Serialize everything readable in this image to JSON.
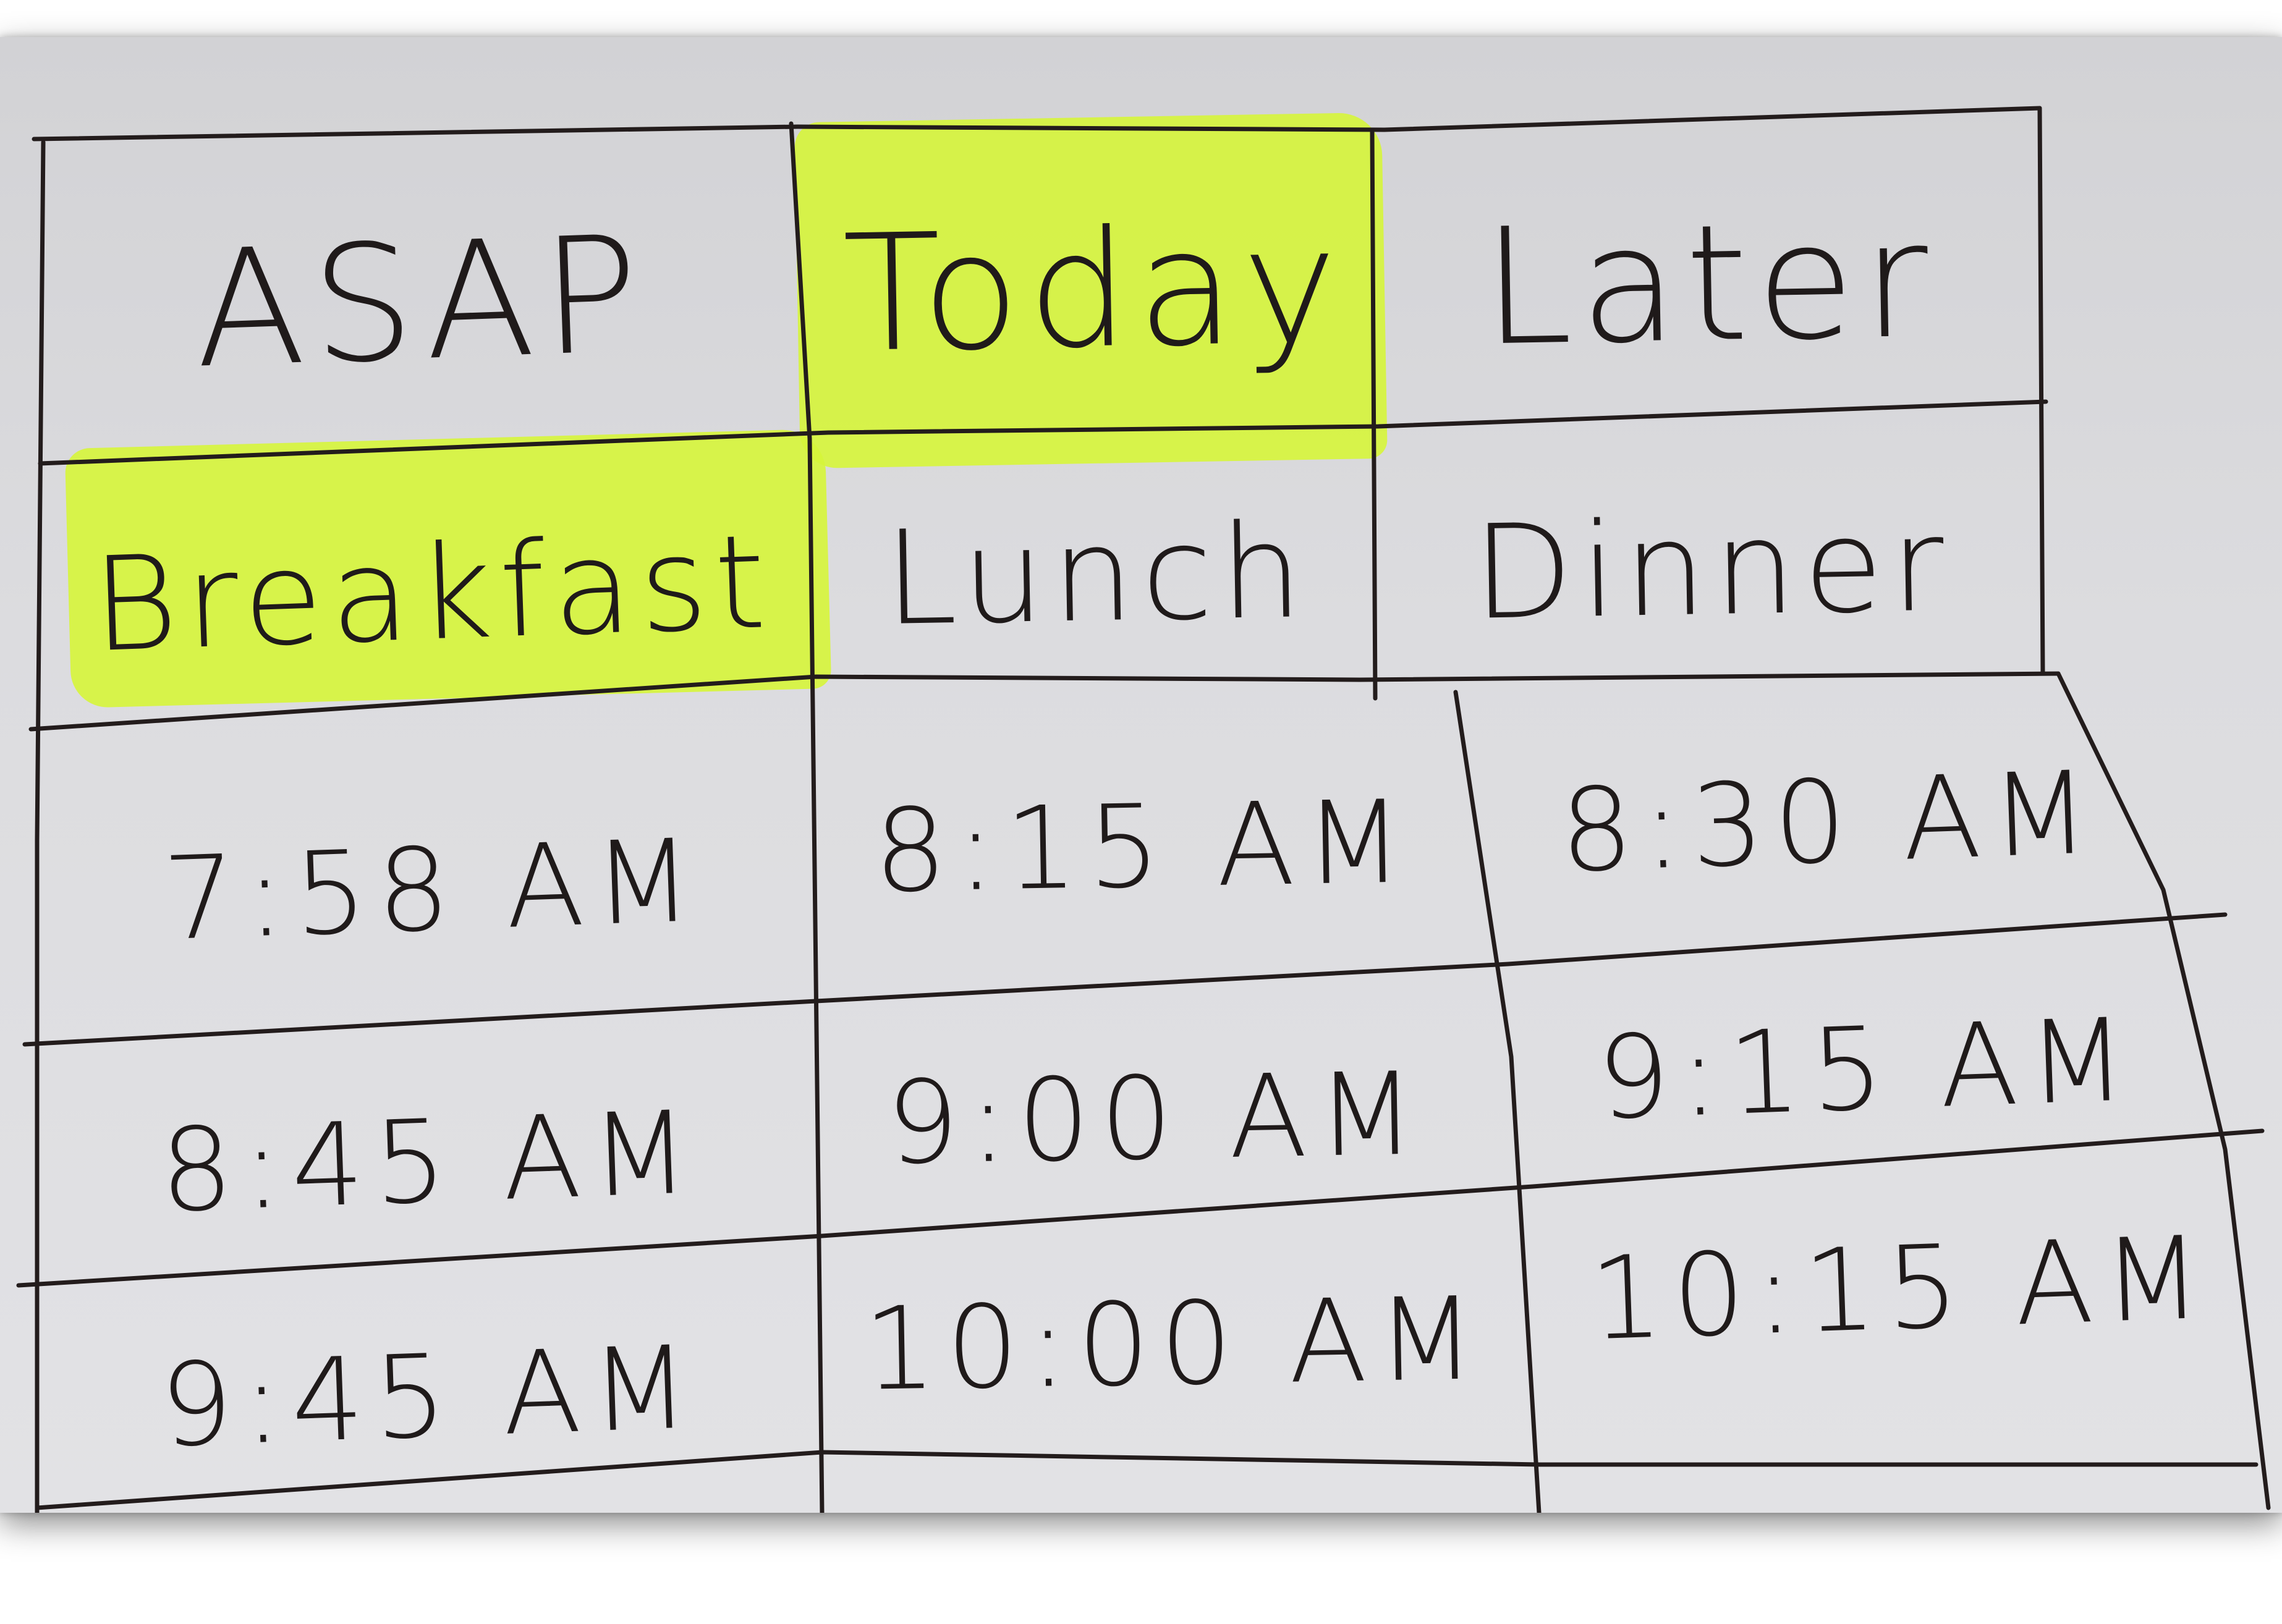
{
  "colors": {
    "highlight": "#d6f53a",
    "ink": "#1f1a1a",
    "paper": "#dcdcdf"
  },
  "board": {
    "schedule_tabs": [
      "ASAP",
      "Today",
      "Later"
    ],
    "selected_schedule": "Today",
    "meals": [
      "Breakfast",
      "Lunch",
      "Dinner"
    ],
    "selected_meal": "Breakfast",
    "times": [
      [
        "7:58 AM",
        "8:15 AM",
        "8:30 AM"
      ],
      [
        "8:45 AM",
        "9:00 AM",
        "9:15 AM"
      ],
      [
        "9:45 AM",
        "10:00 AM",
        "10:15 AM"
      ]
    ]
  }
}
